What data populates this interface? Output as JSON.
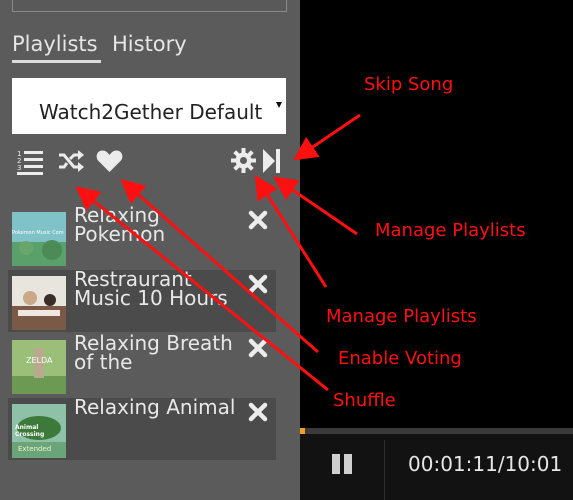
{
  "tabs": {
    "playlists": "Playlists",
    "history": "History"
  },
  "playlist_select": {
    "value": "Watch2Gether Default"
  },
  "toolbar": {
    "icons": [
      "list-icon",
      "shuffle-icon",
      "heart-icon",
      "gear-icon",
      "skip-next-icon"
    ]
  },
  "playlist_items": [
    {
      "title": "Relaxing Pokemon",
      "thumb_text": "Pokemon Music Com"
    },
    {
      "title": "Restraurant Music 10 Hours"
    },
    {
      "title": "Relaxing Breath of the",
      "thumb_text": "ZELDA"
    },
    {
      "title": "Relaxing Animal",
      "thumb_text": "Animal Crossing",
      "thumb_sub": "Extended"
    }
  ],
  "player": {
    "time": "00:01:11/10:01",
    "progress": 0.02
  },
  "annotations": {
    "skip_song": "Skip Song",
    "manage_playlists_1": "Manage Playlists",
    "manage_playlists_2": "Manage Playlists",
    "enable_voting": "Enable Voting",
    "shuffle": "Shuffle"
  },
  "colors": {
    "sidebar": "#5b5b5b",
    "annotation": "#ff1010",
    "progress": "#f0a020"
  }
}
